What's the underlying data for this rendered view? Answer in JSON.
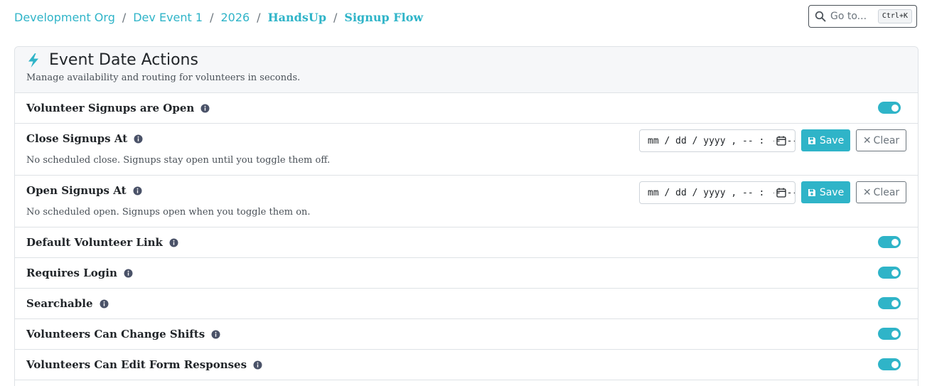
{
  "breadcrumb": [
    {
      "label": "Development Org"
    },
    {
      "label": "Dev Event 1"
    },
    {
      "label": "2026"
    },
    {
      "label": "HandsUp"
    },
    {
      "label": "Signup Flow"
    }
  ],
  "goto": {
    "placeholder": "Go to...",
    "shortcut": "Ctrl+K",
    "icon": "search-icon"
  },
  "card": {
    "icon": "lightning-bolt-icon",
    "title": "Event Date Actions",
    "subtitle": "Manage availability and routing for volunteers in seconds."
  },
  "rows": {
    "signups_open": {
      "label": "Volunteer Signups are Open",
      "enabled": true
    },
    "close_at": {
      "label": "Close Signups At",
      "placeholder": "mm / dd / yyyy ,  -- : --  --",
      "description": "No scheduled close. Signups stay open until you toggle them off.",
      "save_label": "Save",
      "clear_label": "Clear"
    },
    "open_at": {
      "label": "Open Signups At",
      "placeholder": "mm / dd / yyyy ,  -- : --  --",
      "description": "No scheduled open. Signups open when you toggle them on.",
      "save_label": "Save",
      "clear_label": "Clear"
    },
    "default_link": {
      "label": "Default Volunteer Link",
      "enabled": true
    },
    "requires_login": {
      "label": "Requires Login",
      "enabled": true
    },
    "searchable": {
      "label": "Searchable",
      "enabled": true
    },
    "change_shifts": {
      "label": "Volunteers Can Change Shifts",
      "enabled": true
    },
    "edit_responses": {
      "label": "Volunteers Can Edit Form Responses",
      "enabled": true
    }
  },
  "colors": {
    "accent": "#2fb4c8",
    "border": "#dee2e6",
    "header_bg": "#f6f7f9",
    "text": "#212529"
  }
}
